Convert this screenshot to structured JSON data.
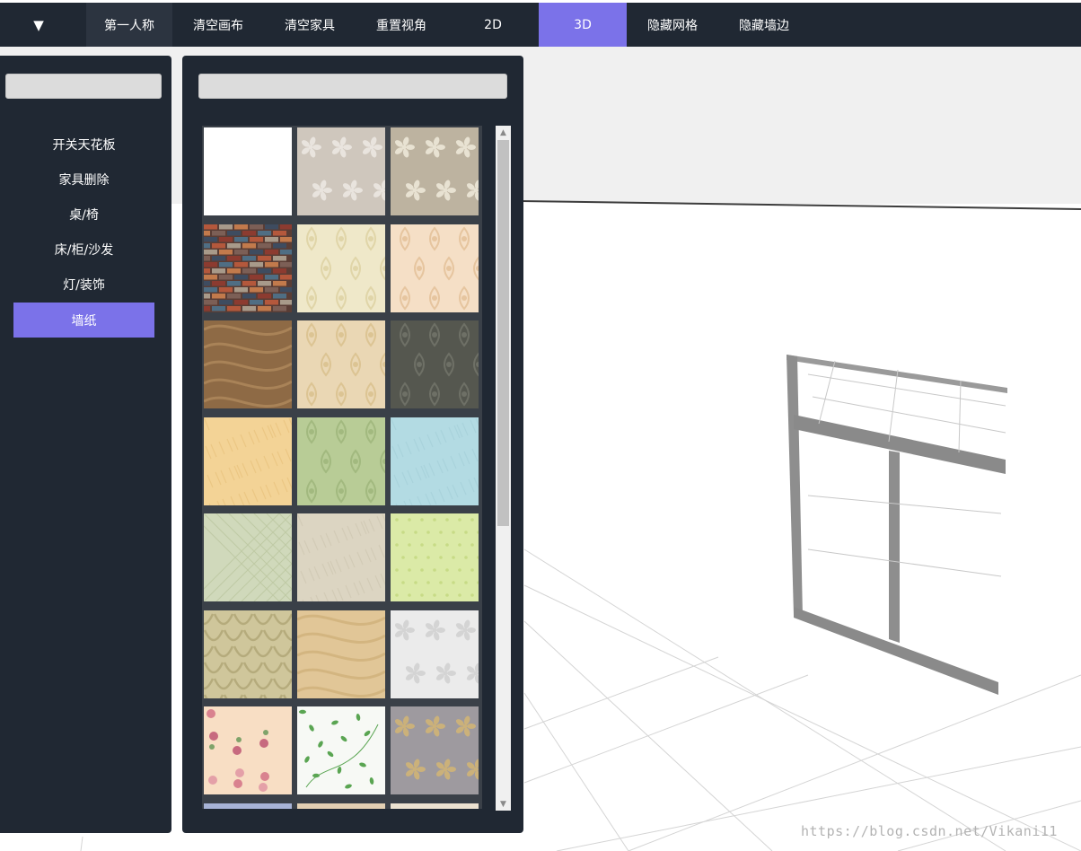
{
  "toolbar": {
    "toggle_icon": "caret-down-icon",
    "toggle_glyph": "▼",
    "items": [
      {
        "label": "第一人称"
      },
      {
        "label": "清空画布"
      },
      {
        "label": "清空家具"
      },
      {
        "label": "重置视角"
      },
      {
        "label": "2D"
      },
      {
        "label": "3D"
      },
      {
        "label": "隐藏网格"
      },
      {
        "label": "隐藏墙边"
      }
    ],
    "active": "3D",
    "active_color": "#7b72e9"
  },
  "sidebar": {
    "search_placeholder": "",
    "items": [
      {
        "label": "开关天花板"
      },
      {
        "label": "家具删除"
      },
      {
        "label": "桌/椅"
      },
      {
        "label": "床/柜/沙发"
      },
      {
        "label": "灯/装饰"
      },
      {
        "label": "墙纸"
      }
    ],
    "active": "墙纸"
  },
  "wallpaper_panel": {
    "search_placeholder": "",
    "tiles": [
      {
        "name": "plain-white",
        "base": "#ffffff",
        "pattern": "none",
        "fg": "#ffffff"
      },
      {
        "name": "grey-floral",
        "base": "#cfc7bd",
        "pattern": "floral",
        "fg": "#e9e4de"
      },
      {
        "name": "taupe-lily",
        "base": "#bdb3a0",
        "pattern": "floral",
        "fg": "#e8e2d2"
      },
      {
        "name": "brick",
        "base": "#5a3d35",
        "pattern": "brick",
        "fg": "#b4583c"
      },
      {
        "name": "cream-damask",
        "base": "#efe8c9",
        "pattern": "damask",
        "fg": "#e0d5a8"
      },
      {
        "name": "peach-damask",
        "base": "#f5dfc6",
        "pattern": "damask",
        "fg": "#e6c59f"
      },
      {
        "name": "brown-swirl",
        "base": "#8e6a45",
        "pattern": "swirl",
        "fg": "#b08a5c"
      },
      {
        "name": "beige-damask",
        "base": "#ead7b4",
        "pattern": "damask",
        "fg": "#dcc493"
      },
      {
        "name": "charcoal-damask",
        "base": "#55574f",
        "pattern": "damask",
        "fg": "#6e7066"
      },
      {
        "name": "yellow-texture",
        "base": "#f3d396",
        "pattern": "texture",
        "fg": "#e9c27d"
      },
      {
        "name": "green-damask",
        "base": "#b8cc96",
        "pattern": "damask",
        "fg": "#a2b97f"
      },
      {
        "name": "light-blue",
        "base": "#b3dbe3",
        "pattern": "texture",
        "fg": "#a5d0d9"
      },
      {
        "name": "sage-lattice",
        "base": "#d0d9bb",
        "pattern": "lattice",
        "fg": "#bfcaa5"
      },
      {
        "name": "linen",
        "base": "#dcd5c2",
        "pattern": "texture",
        "fg": "#cfc7b2"
      },
      {
        "name": "lime-dots",
        "base": "#dbeaa7",
        "pattern": "dots",
        "fg": "#c7db86"
      },
      {
        "name": "olive-scale",
        "base": "#cfc69b",
        "pattern": "scale",
        "fg": "#b5ab7c"
      },
      {
        "name": "gold-vine",
        "base": "#e1c697",
        "pattern": "swirl",
        "fg": "#cfb07a"
      },
      {
        "name": "silver-floral",
        "base": "#ebebeb",
        "pattern": "floral",
        "fg": "#d4d4d4"
      },
      {
        "name": "pink-roses",
        "base": "#f8dec4",
        "pattern": "roses",
        "fg": "#d9828f"
      },
      {
        "name": "green-vine-white",
        "base": "#f7f9f5",
        "pattern": "leaves",
        "fg": "#5aa552"
      },
      {
        "name": "gold-on-grey",
        "base": "#9e9a9f",
        "pattern": "floral",
        "fg": "#cbb17a"
      },
      {
        "name": "blue-stripe",
        "base": "#a7b3d6",
        "pattern": "none",
        "fg": "#a7b3d6"
      },
      {
        "name": "wood-light",
        "base": "#e2cfb3",
        "pattern": "none",
        "fg": "#e2cfb3"
      },
      {
        "name": "pale-stripe",
        "base": "#ebe1d0",
        "pattern": "none",
        "fg": "#ebe1d0"
      }
    ]
  },
  "watermark": "https://blog.csdn.net/Vikani11"
}
